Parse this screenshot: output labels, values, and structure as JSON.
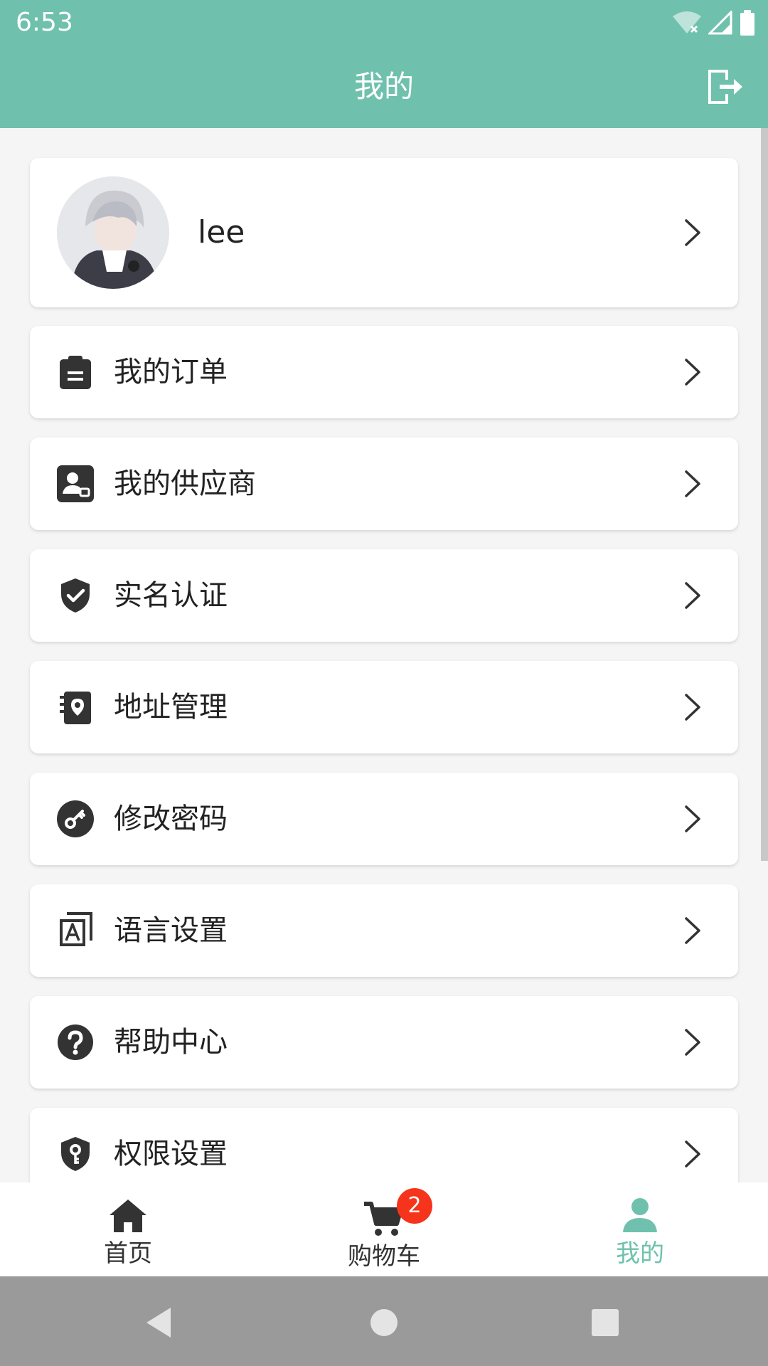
{
  "status_bar": {
    "time": "6:53"
  },
  "header": {
    "title": "我的"
  },
  "profile": {
    "name": "lee"
  },
  "menu": [
    {
      "label": "我的订单",
      "icon": "clipboard-icon"
    },
    {
      "label": "我的供应商",
      "icon": "supplier-badge-icon"
    },
    {
      "label": "实名认证",
      "icon": "verified-shield-icon"
    },
    {
      "label": "地址管理",
      "icon": "address-book-icon"
    },
    {
      "label": "修改密码",
      "icon": "key-icon"
    },
    {
      "label": "语言设置",
      "icon": "language-icon"
    },
    {
      "label": "帮助中心",
      "icon": "help-icon"
    },
    {
      "label": "权限设置",
      "icon": "permission-shield-icon"
    }
  ],
  "bottom_nav": {
    "home": "首页",
    "cart": "购物车",
    "cart_badge": "2",
    "mine": "我的"
  },
  "colors": {
    "brand": "#6fc1ad",
    "badge": "#f5341b"
  }
}
